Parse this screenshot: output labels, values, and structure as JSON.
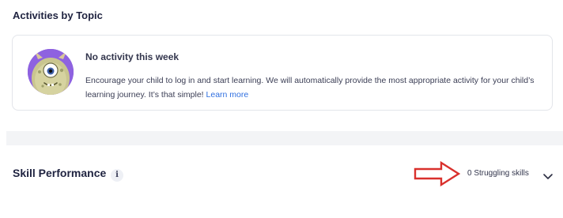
{
  "activities": {
    "title": "Activities by Topic",
    "empty_state": {
      "title": "No activity this week",
      "body": "Encourage your child to log in and start learning. We will automatically provide the most appropriate activity for your child’s learning journey. It’s that simple!",
      "link": "Learn more"
    },
    "avatar_icon": "monster-avatar-icon"
  },
  "skill_performance": {
    "title": "Skill Performance",
    "info_glyph": "i",
    "struggling_label": "0 Struggling skills",
    "annotation_icon": "red-arrow-icon",
    "expand_icon": "chevron-down-icon"
  },
  "colors": {
    "link": "#2f6fe0",
    "annotation_arrow": "#d9302c",
    "avatar_ring": "#7b4fd6"
  }
}
